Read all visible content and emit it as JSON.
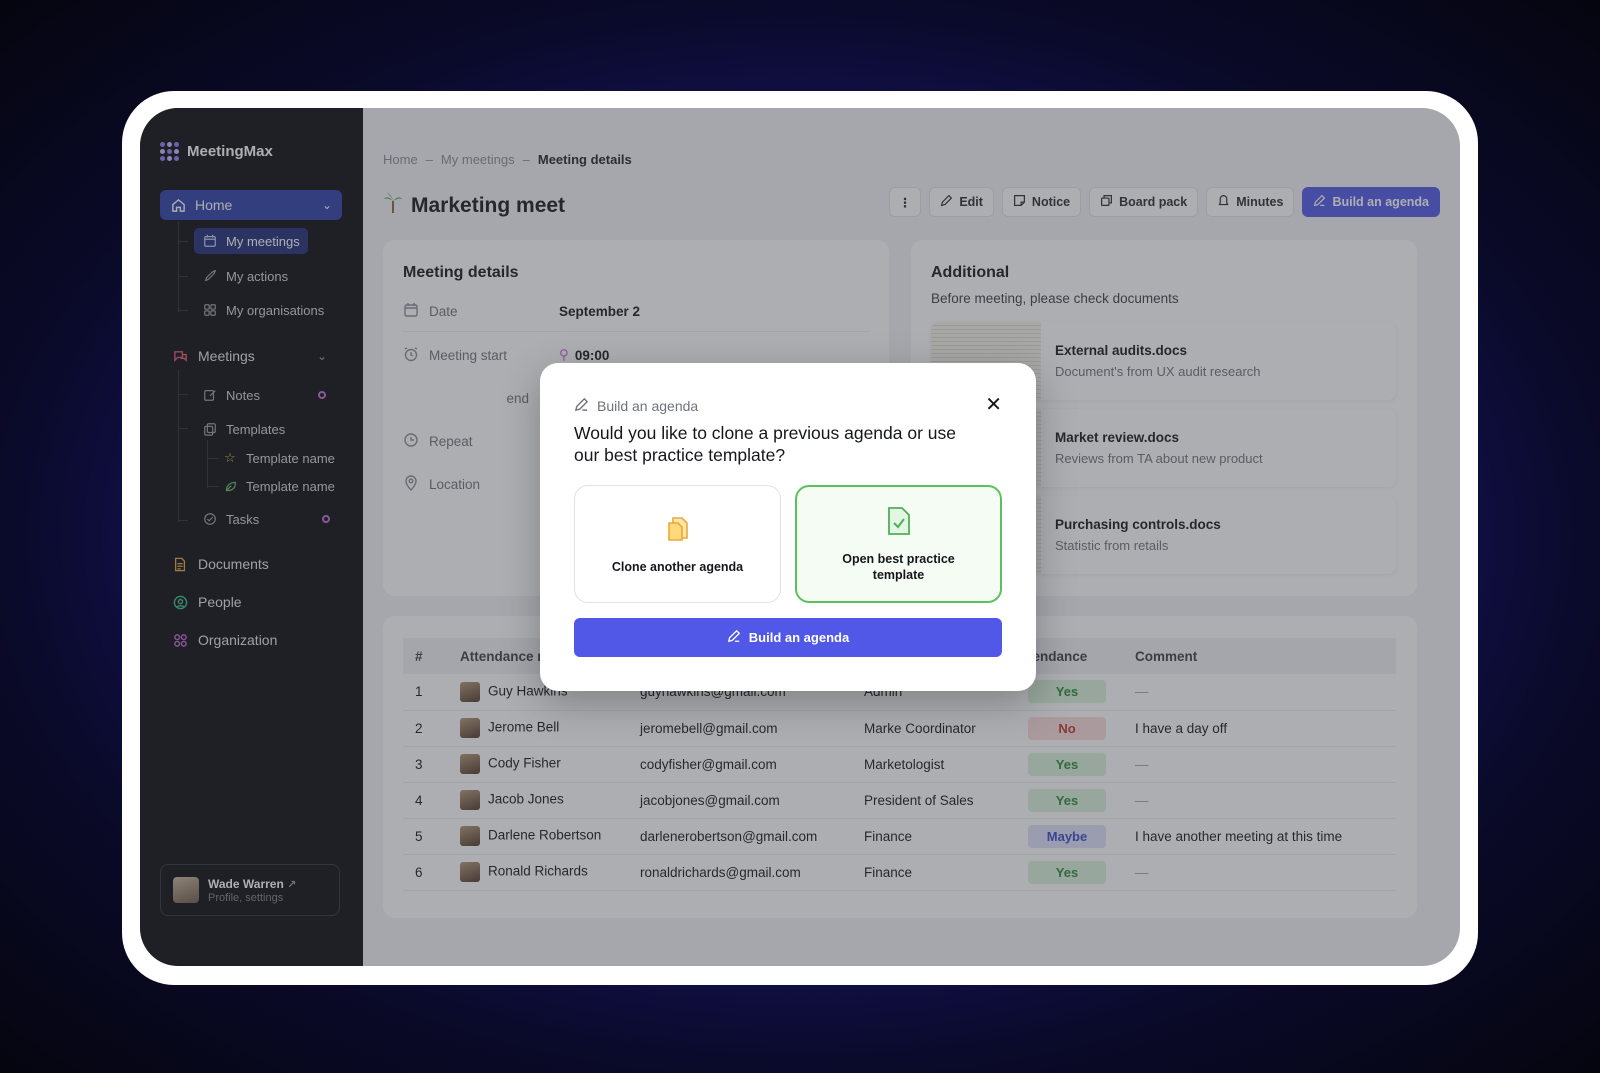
{
  "app": {
    "name": "MeetingMax"
  },
  "sidebar": {
    "home": "Home",
    "home_items": [
      "My meetings",
      "My actions",
      "My organisations"
    ],
    "meetings": "Meetings",
    "meetings_items": {
      "notes": "Notes",
      "templates": "Templates",
      "template1": "Template name",
      "template2": "Template name",
      "tasks": "Tasks"
    },
    "documents": "Documents",
    "people": "People",
    "organization": "Organization",
    "profile": {
      "name": "Wade Warren",
      "sub": "Profile, settings"
    }
  },
  "breadcrumb": {
    "home": "Home",
    "sep": "–",
    "meetings": "My meetings",
    "current": "Meeting details"
  },
  "page": {
    "title": "Marketing meet"
  },
  "toolbar": {
    "edit": "Edit",
    "notice": "Notice",
    "board_pack": "Board pack",
    "minutes": "Minutes",
    "build": "Build an agenda"
  },
  "details": {
    "heading": "Meeting details",
    "date_label": "Date",
    "date_value": "September 2",
    "start_label": "Meeting start",
    "start_value": "09:00",
    "end_label": "end",
    "repeat_label": "Repeat",
    "location_label": "Location"
  },
  "additional": {
    "heading": "Additional",
    "subtitle": "Before meeting, please check documents",
    "docs": [
      {
        "name": "External audits.docs",
        "desc": "Document's from UX audit research"
      },
      {
        "name": "Market review.docs",
        "desc": "Reviews from TA about new product"
      },
      {
        "name": "Purchasing controls.docs",
        "desc": "Statistic from retails"
      }
    ]
  },
  "attendance": {
    "headers": {
      "num": "#",
      "name": "Attendance na",
      "email": "",
      "role": "",
      "att": "tendance",
      "comment": "Comment"
    },
    "rows": [
      {
        "n": "1",
        "name": "Guy Hawkins",
        "email": "guyhawkins@gmail.com",
        "role": "Admin",
        "att": "Yes",
        "comment": "—"
      },
      {
        "n": "2",
        "name": "Jerome Bell",
        "email": "jeromebell@gmail.com",
        "role": "Marke Coordinator",
        "att": "No",
        "comment": "I have a day off"
      },
      {
        "n": "3",
        "name": "Cody Fisher",
        "email": "codyfisher@gmail.com",
        "role": "Marketologist",
        "att": "Yes",
        "comment": "—"
      },
      {
        "n": "4",
        "name": "Jacob Jones",
        "email": "jacobjones@gmail.com",
        "role": "President of Sales",
        "att": "Yes",
        "comment": "—"
      },
      {
        "n": "5",
        "name": "Darlene Robertson",
        "email": "darlenerobertson@gmail.com",
        "role": "Finance",
        "att": "Maybe",
        "comment": "I have another meeting at this time"
      },
      {
        "n": "6",
        "name": "Ronald Richards",
        "email": "ronaldrichards@gmail.com",
        "role": "Finance",
        "att": "Yes",
        "comment": "—"
      }
    ]
  },
  "modal": {
    "kicker": "Build an agenda",
    "question": "Would you like to clone a previous agenda or use our best practice template?",
    "option_clone": "Clone another agenda",
    "option_template": "Open best practice template",
    "button": "Build an agenda"
  },
  "colors": {
    "accent": "#5158e8",
    "sidebar_active": "#2d3ea8",
    "yes": "#2e8b3d",
    "no": "#c0392b",
    "maybe": "#3f48c7",
    "selected_border": "#59c25f"
  }
}
